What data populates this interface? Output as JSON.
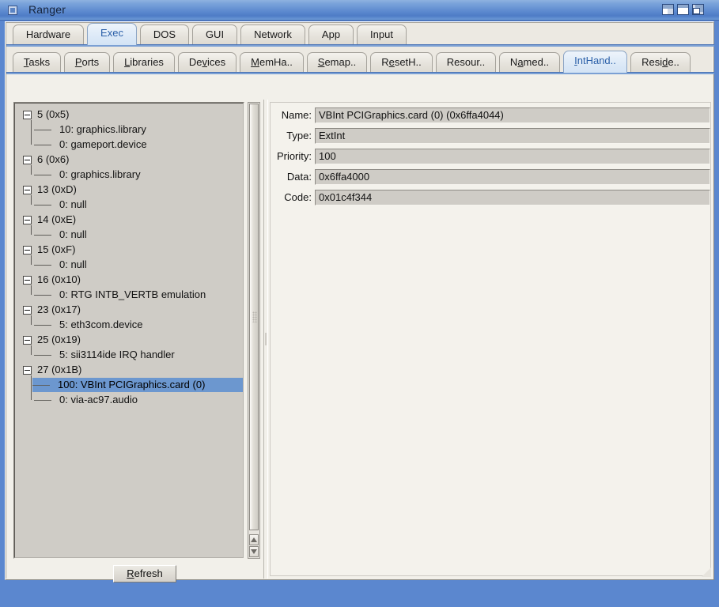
{
  "window": {
    "title": "Ranger",
    "icon": "window-menu-icon",
    "buttons": [
      {
        "name": "minimize-button",
        "label": "Minimize"
      },
      {
        "name": "maximize-button",
        "label": "Maximize"
      },
      {
        "name": "restore-button",
        "label": "Restore"
      }
    ]
  },
  "colors": {
    "titlebar_blue": "#5b87cf",
    "frame_blue": "#5b87cf",
    "tab_selected_text": "#2a5fa8",
    "selection_blue": "#6c97cf",
    "panel_bg": "#f2f0ea",
    "field_bg": "#cfccc6"
  },
  "tabs_primary": {
    "selected": "Exec",
    "items": [
      {
        "label": "Hardware",
        "selected": false
      },
      {
        "label": "Exec",
        "selected": true
      },
      {
        "label": "DOS",
        "selected": false
      },
      {
        "label": "GUI",
        "selected": false
      },
      {
        "label": "Network",
        "selected": false
      },
      {
        "label": "App",
        "selected": false
      },
      {
        "label": "Input",
        "selected": false
      }
    ]
  },
  "tabs_secondary": {
    "selected": "IntHand..",
    "items": [
      {
        "label": "Tasks",
        "mnemonic": "T",
        "selected": false
      },
      {
        "label": "Ports",
        "mnemonic": "P",
        "selected": false
      },
      {
        "label": "Libraries",
        "mnemonic": "L",
        "selected": false
      },
      {
        "label": "Devices",
        "mnemonic": "v",
        "selected": false
      },
      {
        "label": "MemHa..",
        "mnemonic": "M",
        "selected": false
      },
      {
        "label": "Semap..",
        "mnemonic": "S",
        "selected": false
      },
      {
        "label": "ResetH..",
        "mnemonic": "e",
        "selected": false
      },
      {
        "label": "Resour..",
        "mnemonic": "",
        "selected": false
      },
      {
        "label": "Named..",
        "mnemonic": "a",
        "selected": false
      },
      {
        "label": "IntHand..",
        "mnemonic": "I",
        "selected": true
      },
      {
        "label": "Reside..",
        "mnemonic": "d",
        "selected": false
      }
    ]
  },
  "tree": {
    "nodes": [
      {
        "type": "root",
        "label": "5 (0x5)",
        "expanded": true,
        "selected": false
      },
      {
        "type": "child",
        "label": "10: graphics.library",
        "selected": false
      },
      {
        "type": "child",
        "label": "0: gameport.device",
        "selected": false
      },
      {
        "type": "root",
        "label": "6 (0x6)",
        "expanded": true,
        "selected": false
      },
      {
        "type": "child",
        "label": "0: graphics.library",
        "selected": false
      },
      {
        "type": "root",
        "label": "13 (0xD)",
        "expanded": true,
        "selected": false
      },
      {
        "type": "child",
        "label": "0: null",
        "selected": false
      },
      {
        "type": "root",
        "label": "14 (0xE)",
        "expanded": true,
        "selected": false
      },
      {
        "type": "child",
        "label": "0: null",
        "selected": false
      },
      {
        "type": "root",
        "label": "15 (0xF)",
        "expanded": true,
        "selected": false
      },
      {
        "type": "child",
        "label": "0: null",
        "selected": false
      },
      {
        "type": "root",
        "label": "16 (0x10)",
        "expanded": true,
        "selected": false
      },
      {
        "type": "child",
        "label": "0: RTG INTB_VERTB emulation",
        "selected": false
      },
      {
        "type": "root",
        "label": "23 (0x17)",
        "expanded": true,
        "selected": false
      },
      {
        "type": "child",
        "label": "5: eth3com.device",
        "selected": false
      },
      {
        "type": "root",
        "label": "25 (0x19)",
        "expanded": true,
        "selected": false
      },
      {
        "type": "child",
        "label": "5: sii3114ide IRQ handler",
        "selected": false
      },
      {
        "type": "root",
        "label": "27 (0x1B)",
        "expanded": true,
        "selected": false
      },
      {
        "type": "child",
        "label": "100: VBInt PCIGraphics.card (0)",
        "selected": true
      },
      {
        "type": "child",
        "label": "0: via-ac97.audio",
        "selected": false
      }
    ]
  },
  "scrollbar": {
    "up_arrow": "scroll-up-arrow",
    "down_arrow": "scroll-down-arrow"
  },
  "refresh": {
    "label": "Refresh",
    "mnemonic": "R",
    "rest": "efresh"
  },
  "detail": {
    "rows": [
      {
        "label": "Name:",
        "value": "VBInt PCIGraphics.card (0) (0x6ffa4044)"
      },
      {
        "label": "Type:",
        "value": "ExtInt"
      },
      {
        "label": "Priority:",
        "value": "100"
      },
      {
        "label": "Data:",
        "value": "0x6ffa4000"
      },
      {
        "label": "Code:",
        "value": "0x01c4f344"
      }
    ]
  }
}
